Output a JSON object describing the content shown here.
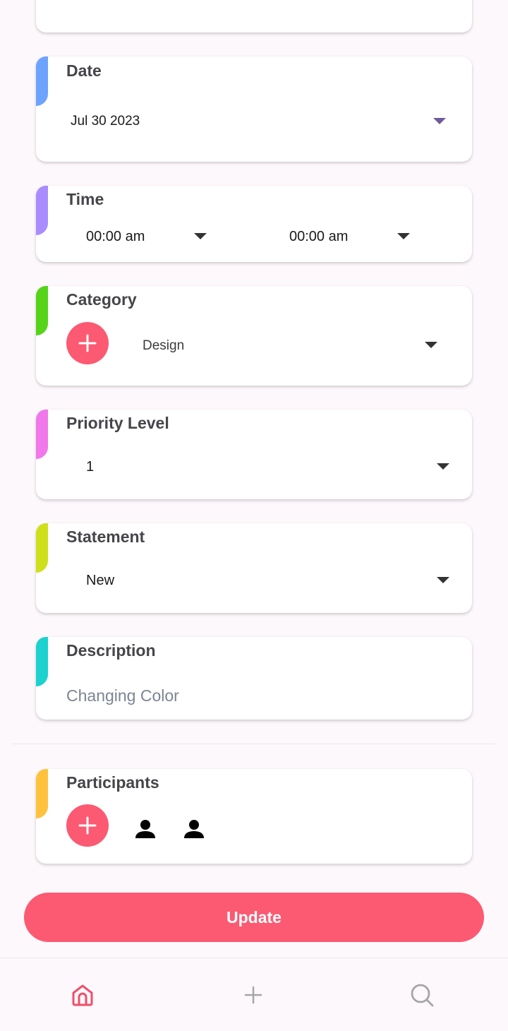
{
  "colors": {
    "accent_date": "#6ea2ff",
    "accent_time": "#a98cff",
    "accent_category": "#55d41a",
    "accent_priority": "#f078ea",
    "accent_statement": "#cfe01a",
    "accent_description": "#1bd2cf",
    "accent_participants": "#ffc23c",
    "primary": "#fb5a72"
  },
  "date": {
    "title": "Date",
    "value": "Jul 30 2023"
  },
  "time": {
    "title": "Time",
    "start": "00:00 am",
    "end": "00:00 am"
  },
  "category": {
    "title": "Category",
    "value": "Design"
  },
  "priority": {
    "title": "Priority Level",
    "value": "1"
  },
  "statement": {
    "title": "Statement",
    "value": "New"
  },
  "description": {
    "title": "Description",
    "value": "Changing Color"
  },
  "participants": {
    "title": "Participants",
    "icons": [
      "person-icon",
      "person-icon"
    ]
  },
  "actions": {
    "update_label": "Update"
  },
  "nav": {
    "items": [
      "home-icon",
      "plus-icon",
      "search-icon"
    ]
  }
}
